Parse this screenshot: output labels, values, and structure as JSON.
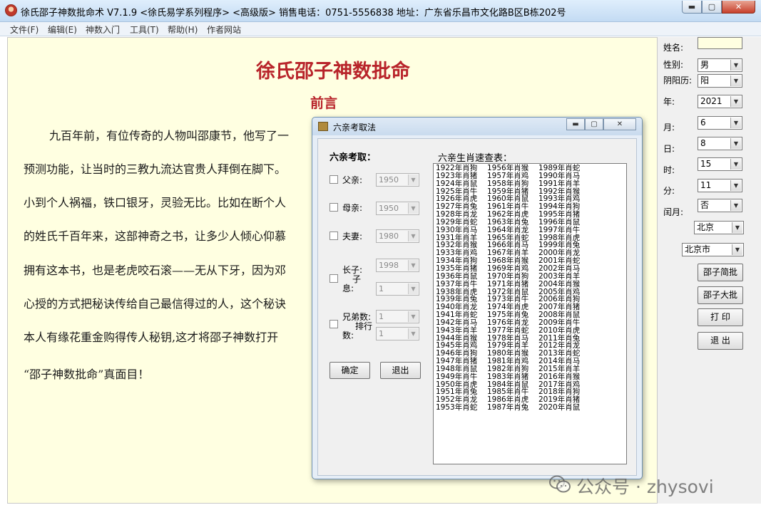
{
  "window": {
    "title": "徐氏邵子神数批命术 V7.1.9 <徐氏易学系列程序> <高级版>    销售电话：0751-5556838    地址：广东省乐昌市文化路B区B栋202号",
    "minimize": "▬",
    "maximize": "▢",
    "close": "✕"
  },
  "menu": [
    "文件(F)",
    "编辑(E)",
    "神数入门",
    "工具(T)",
    "帮助(H)",
    "作者网站"
  ],
  "document": {
    "title": "徐氏邵子神数批命",
    "subtitle": "前言",
    "lines": [
      "九百年前，有位传奇的人物叫邵康节，他写了一",
      "预测功能，让当时的三教九流达官贵人拜倒在脚下。",
      "小到个人祸福，铁口银牙，灵验无比。比如在断个人",
      "的姓氏千百年来，这部神奇之书，让多少人倾心仰慕",
      "拥有这本书，也是老虎咬石滚——无从下牙，因为邓",
      "心授的方式把秘诀传给自己最信得过的人，这个秘诀",
      "本人有缘花重金购得传人秘钥,这才将邵子神数打开",
      "“邵子神数批命”真面目！"
    ]
  },
  "right_panel": {
    "name_label": "姓名:",
    "name_value": "",
    "gender_label": "性别:",
    "gender_value": "男",
    "calendar_label": "阴阳历:",
    "calendar_value": "阳",
    "year_label": "年:",
    "year_value": "2021",
    "month_label": "月:",
    "month_value": "6",
    "day_label": "日:",
    "day_value": "8",
    "hour_label": "时:",
    "hour_value": "15",
    "minute_label": "分:",
    "minute_value": "11",
    "leap_label": "闰月:",
    "leap_value": "否",
    "province_value": "北京",
    "city_value": "北京市",
    "btn_brief": "邵子简批",
    "btn_detail": "邵子大批",
    "btn_print": "打 印",
    "btn_exit": "退 出"
  },
  "dialog": {
    "title": "六亲考取法",
    "section_left": "六亲考取：",
    "section_right": "六亲生肖速查表：",
    "father_label": "父亲:",
    "father_year": "1950",
    "mother_label": "母亲:",
    "mother_year": "1950",
    "spouse_label": "夫妻:",
    "spouse_year": "1980",
    "son_label_a": "长子:",
    "son_label_b": "子",
    "son_label_c": "息:",
    "son_year": "1998",
    "son_count": "1",
    "sibling_label_a": "兄弟数:",
    "sibling_label_b": "排行",
    "sibling_label_c": "数:",
    "sibling_count": "1",
    "sibling_rank": "1",
    "ok_button": "确定",
    "exit_button": "退出",
    "zodiac_rows": [
      [
        "1922年肖狗",
        "1956年肖猴",
        "1989年肖蛇"
      ],
      [
        "1923年肖猪",
        "1957年肖鸡",
        "1990年肖马"
      ],
      [
        "1924年肖鼠",
        "1958年肖狗",
        "1991年肖羊"
      ],
      [
        "1925年肖牛",
        "1959年肖猪",
        "1992年肖猴"
      ],
      [
        "1926年肖虎",
        "1960年肖鼠",
        "1993年肖鸡"
      ],
      [
        "1927年肖兔",
        "1961年肖牛",
        "1994年肖狗"
      ],
      [
        "1928年肖龙",
        "1962年肖虎",
        "1995年肖猪"
      ],
      [
        "1929年肖蛇",
        "1963年肖兔",
        "1996年肖鼠"
      ],
      [
        "1930年肖马",
        "1964年肖龙",
        "1997年肖牛"
      ],
      [
        "1931年肖羊",
        "1965年肖蛇",
        "1998年肖虎"
      ],
      [
        "1932年肖猴",
        "1966年肖马",
        "1999年肖兔"
      ],
      [
        "1933年肖鸡",
        "1967年肖羊",
        "2000年肖龙"
      ],
      [
        "1934年肖狗",
        "1968年肖猴",
        "2001年肖蛇"
      ],
      [
        "1935年肖猪",
        "1969年肖鸡",
        "2002年肖马"
      ],
      [
        "1936年肖鼠",
        "1970年肖狗",
        "2003年肖羊"
      ],
      [
        "1937年肖牛",
        "1971年肖猪",
        "2004年肖猴"
      ],
      [
        "1938年肖虎",
        "1972年肖鼠",
        "2005年肖鸡"
      ],
      [
        "1939年肖兔",
        "1973年肖牛",
        "2006年肖狗"
      ],
      [
        "1940年肖龙",
        "1974年肖虎",
        "2007年肖猪"
      ],
      [
        "1941年肖蛇",
        "1975年肖兔",
        "2008年肖鼠"
      ],
      [
        "1942年肖马",
        "1976年肖龙",
        "2009年肖牛"
      ],
      [
        "1943年肖羊",
        "1977年肖蛇",
        "2010年肖虎"
      ],
      [
        "1944年肖猴",
        "1978年肖马",
        "2011年肖兔"
      ],
      [
        "1945年肖鸡",
        "1979年肖羊",
        "2012年肖龙"
      ],
      [
        "1946年肖狗",
        "1980年肖猴",
        "2013年肖蛇"
      ],
      [
        "1947年肖猪",
        "1981年肖鸡",
        "2014年肖马"
      ],
      [
        "1948年肖鼠",
        "1982年肖狗",
        "2015年肖羊"
      ],
      [
        "1949年肖牛",
        "1983年肖猪",
        "2016年肖猴"
      ],
      [
        "1950年肖虎",
        "1984年肖鼠",
        "2017年肖鸡"
      ],
      [
        "1951年肖兔",
        "1985年肖牛",
        "2018年肖狗"
      ],
      [
        "1952年肖龙",
        "1986年肖虎",
        "2019年肖猪"
      ],
      [
        "1953年肖蛇",
        "1987年肖兔",
        "2020年肖鼠"
      ]
    ]
  },
  "watermark": "公众号 · zhysovi"
}
